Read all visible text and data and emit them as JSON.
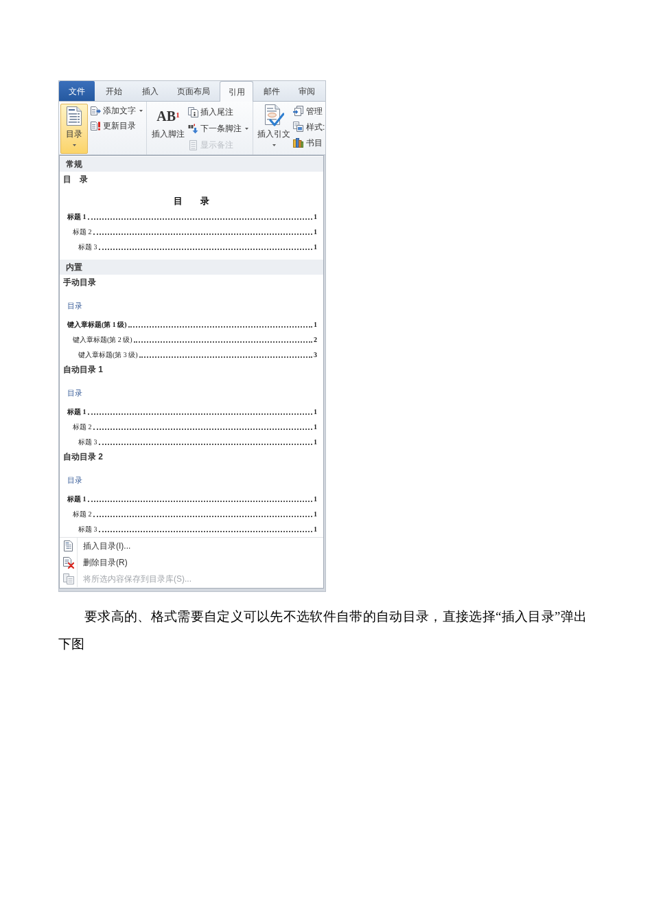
{
  "ribbon": {
    "tabs": [
      {
        "label": "文件",
        "kind": "file",
        "selected": false
      },
      {
        "label": "开始",
        "kind": "tab",
        "selected": false
      },
      {
        "label": "插入",
        "kind": "tab",
        "selected": false
      },
      {
        "label": "页面布局",
        "kind": "tab",
        "selected": false
      },
      {
        "label": "引用",
        "kind": "tab",
        "selected": true
      },
      {
        "label": "邮件",
        "kind": "tab",
        "selected": false
      },
      {
        "label": "审阅",
        "kind": "tab",
        "selected": false
      }
    ],
    "groups": [
      {
        "large_button": {
          "label": "目录",
          "dropdown": true,
          "pressed": true
        },
        "small_buttons": [
          {
            "label": "添加文字",
            "dropdown": true,
            "disabled": false
          },
          {
            "label": "更新目录",
            "dropdown": false,
            "disabled": false
          }
        ]
      },
      {
        "large_button": {
          "label": "插入脚注",
          "glyph": "AB$^{1}$",
          "dropdown": false,
          "pressed": false
        },
        "small_buttons": [
          {
            "label": "插入尾注",
            "dropdown": false,
            "disabled": false
          },
          {
            "label": "下一条脚注",
            "dropdown": true,
            "disabled": false
          },
          {
            "label": "显示备注",
            "dropdown": false,
            "disabled": true
          }
        ]
      },
      {
        "large_button": {
          "label": "插入引文",
          "dropdown": true,
          "pressed": false
        },
        "small_buttons": [
          {
            "label": "管理",
            "dropdown": false,
            "disabled": false
          },
          {
            "label": "样式:",
            "dropdown": false,
            "disabled": false
          },
          {
            "label": "书目",
            "dropdown": false,
            "disabled": false
          }
        ]
      }
    ]
  },
  "toc_menu": {
    "sections": [
      {
        "title": "常规",
        "items": [
          {
            "label": "目　录",
            "preview": {
              "kind": "plain",
              "heading": "目　　录",
              "entries": [
                {
                  "title": "标题 1",
                  "page": "1",
                  "children": [
                    {
                      "title": "标题 2",
                      "page": "1",
                      "children": [
                        {
                          "title": "标题 3",
                          "page": "1"
                        }
                      ]
                    }
                  ]
                }
              ]
            }
          }
        ]
      },
      {
        "title": "内置",
        "items": [
          {
            "label": "手动目录",
            "preview": {
              "kind": "styled",
              "heading": "目录",
              "entries": [
                {
                  "title": "键入章标题(第 1 级)",
                  "page": "1",
                  "children": [
                    {
                      "title": "键入章标题(第 2 级)",
                      "page": "2",
                      "children": [
                        {
                          "title": "键入章标题(第 3 级)",
                          "page": "3"
                        }
                      ]
                    }
                  ]
                }
              ]
            }
          },
          {
            "label": "自动目录 1",
            "preview": {
              "kind": "styled",
              "heading": "目录",
              "entries": [
                {
                  "title": "标题 1",
                  "page": "1",
                  "children": [
                    {
                      "title": "标题 2",
                      "page": "1",
                      "children": [
                        {
                          "title": "标题 3",
                          "page": "1"
                        }
                      ]
                    }
                  ]
                }
              ]
            }
          },
          {
            "label": "自动目录 2",
            "preview": {
              "kind": "styled",
              "heading": "目录",
              "entries": [
                {
                  "title": "标题 1",
                  "page": "1",
                  "children": [
                    {
                      "title": "标题 2",
                      "page": "1",
                      "children": [
                        {
                          "title": "标题 3",
                          "page": "1"
                        }
                      ]
                    }
                  ]
                }
              ]
            }
          }
        ]
      }
    ],
    "commands": [
      {
        "label": "插入目录(I)...",
        "disabled": false
      },
      {
        "label": "删除目录(R)",
        "disabled": false
      },
      {
        "label": "将所选内容保存到目录库(S)...",
        "disabled": true
      }
    ]
  },
  "body_text": "要求高的、格式需要自定义可以先不选软件自带的自动目录，直接选择“插入目录”弹出下图"
}
